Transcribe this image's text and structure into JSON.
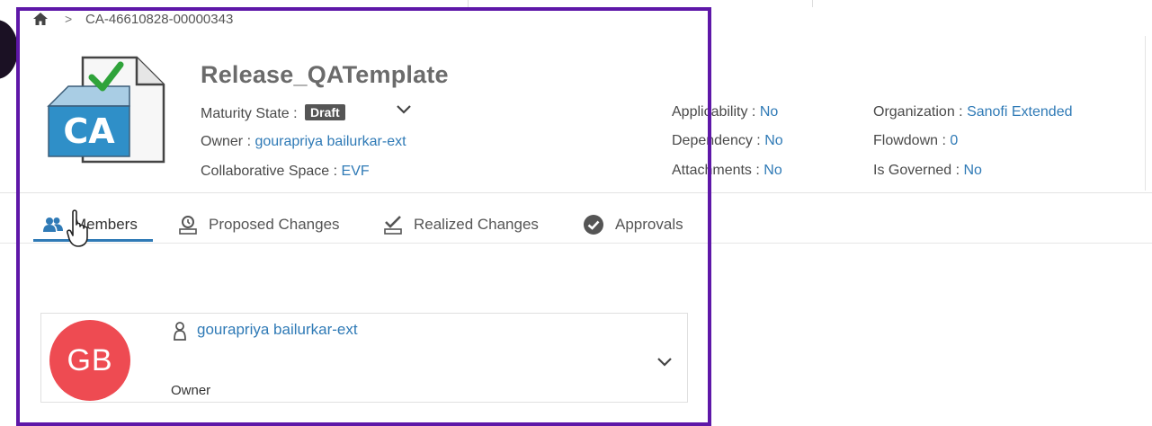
{
  "breadcrumb": {
    "separator": ">",
    "current": "CA-46610828-00000343"
  },
  "object": {
    "icon_label": "CA",
    "title": "Release_QATemplate",
    "maturity_label": "Maturity State :",
    "maturity_value": "Draft",
    "owner_label": "Owner :",
    "owner_value": "gourapriya bailurkar-ext",
    "space_label": "Collaborative Space :",
    "space_value": "EVF"
  },
  "attributes": {
    "applicability_label": "Applicability :",
    "applicability_value": "No",
    "dependency_label": "Dependency :",
    "dependency_value": "No",
    "attachments_label": "Attachments :",
    "attachments_value": "No",
    "organization_label": "Organization :",
    "organization_value": "Sanofi Extended",
    "flowdown_label": "Flowdown :",
    "flowdown_value": "0",
    "governed_label": "Is Governed :",
    "governed_value": "No"
  },
  "tabs": [
    {
      "label": "Members",
      "icon": "members-icon",
      "active": true
    },
    {
      "label": "Proposed Changes",
      "icon": "proposed-changes-icon",
      "active": false
    },
    {
      "label": "Realized Changes",
      "icon": "realized-changes-icon",
      "active": false
    },
    {
      "label": "Approvals",
      "icon": "approvals-icon",
      "active": false
    }
  ],
  "members": [
    {
      "initials": "GB",
      "name": "gourapriya bailurkar-ext",
      "role": "Owner"
    }
  ],
  "colors": {
    "link": "#2f7ab6",
    "avatar": "#ee4b52",
    "highlight": "#5e17a8",
    "badge": "#555555"
  }
}
